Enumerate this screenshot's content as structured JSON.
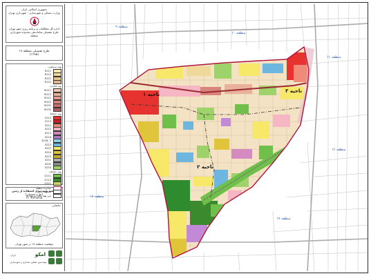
{
  "legend": {
    "header_lines": [
      "جمهوری اسلامی ایران",
      "وزارت مسکن و شهرسازی - شهرداری تهران",
      "اداره کل مطالعات و برنامه ریزی شهر تهران",
      "طرح تفصیلی ساماندهی محدوده شهرداری منطقه"
    ],
    "plan_title": "طرح تفصیلی منطقه ۱۷",
    "plan_year": "(۱۳۸۵)",
    "sections": [
      {
        "title": "پهنه مسکونی",
        "items": [
          {
            "code": "R111",
            "color": "#f3e8b5"
          },
          {
            "code": "R112",
            "color": "#eed99a"
          },
          {
            "code": "R121",
            "color": "#e8c98b"
          },
          {
            "code": "R122",
            "color": "#dcb88a"
          }
        ]
      },
      {
        "title": "پهنه فعالیت",
        "items": [
          {
            "code": "M111",
            "color": "#f2c7b0"
          },
          {
            "code": "M112",
            "color": "#e9b09a"
          },
          {
            "code": "M121",
            "color": "#e59c8e"
          },
          {
            "code": "M122",
            "color": "#d8847a"
          },
          {
            "code": "M131",
            "color": "#c9706a"
          },
          {
            "code": "M132",
            "color": "#b65e5e"
          }
        ]
      },
      {
        "title": "پهنه مختلط",
        "items": [
          {
            "code": "S112",
            "color": "#e7332f"
          },
          {
            "code": "S113",
            "color": "#c8202a"
          },
          {
            "code": "S221",
            "color": "#f08b7a"
          },
          {
            "code": "S212",
            "color": "#f7b6c3"
          },
          {
            "code": "S213",
            "color": "#d58ac0"
          },
          {
            "code": "S216",
            "color": "#a77ac0"
          },
          {
            "code": "S218, 2",
            "color": "#8fd0e8"
          },
          {
            "code": "S223",
            "color": "#6db6e0"
          },
          {
            "code": "S222",
            "color": "#f7e86a"
          },
          {
            "code": "S224",
            "color": "#e0c43a"
          },
          {
            "code": "S225",
            "color": "#c9a92e"
          },
          {
            "code": "S231",
            "color": "#b0b0b0"
          },
          {
            "code": "S232",
            "color": "#8a8a8a"
          },
          {
            "code": "S233",
            "color": "#9ed26a"
          }
        ]
      },
      {
        "title": "پهنه حفاظت",
        "items": [
          {
            "code": "G111",
            "color": "#6fbf4a"
          },
          {
            "code": "G112",
            "color": "#3b8a2e"
          },
          {
            "code": "G121",
            "color": "#c7d86a"
          }
        ]
      }
    ],
    "notes": [
      "محدوده منطقه",
      "محدوده ناحیه",
      "مرز پهنه های زیر پهنه ها"
    ],
    "title_box": {
      "line1": "نقشه پهنه بندی استفاده از زمین",
      "line2": "(طرح تفصیلی)",
      "line3": "۲۶۰۹/۳/۱۵-۸۵"
    },
    "key_map_title": "جانمایی",
    "key_map_caption": "موقعیت منطقه ۱۷ در شهر تهران",
    "company_name": "امکو",
    "company_suffix": "ایران",
    "company_subtitle": "مهندسین مشاور معماری و شهرسازی"
  },
  "map": {
    "neighbors": [
      {
        "label": "منطقه ۹"
      },
      {
        "label": "منطقه ۱۰"
      },
      {
        "label": "منطقه ۱۱"
      },
      {
        "label": "منطقه ۱۶"
      },
      {
        "label": "منطقه ۱۸"
      },
      {
        "label": "منطقه ۱۹"
      }
    ],
    "districts": [
      {
        "label": "ناحیه ۱"
      },
      {
        "label": "ناحیه ۲"
      },
      {
        "label": "ناحیه ۳"
      }
    ],
    "colors": {
      "boundary": "#b0123a",
      "street": "#b8b8b8",
      "background_block": "#f6f6f6",
      "residential": "#f3e3c4",
      "green": "#2e8b2e",
      "light_green": "#9ed26a",
      "red": "#e7332f",
      "blue": "#6db6e0",
      "yellow": "#f7e86a",
      "purple": "#c28ad6"
    }
  }
}
